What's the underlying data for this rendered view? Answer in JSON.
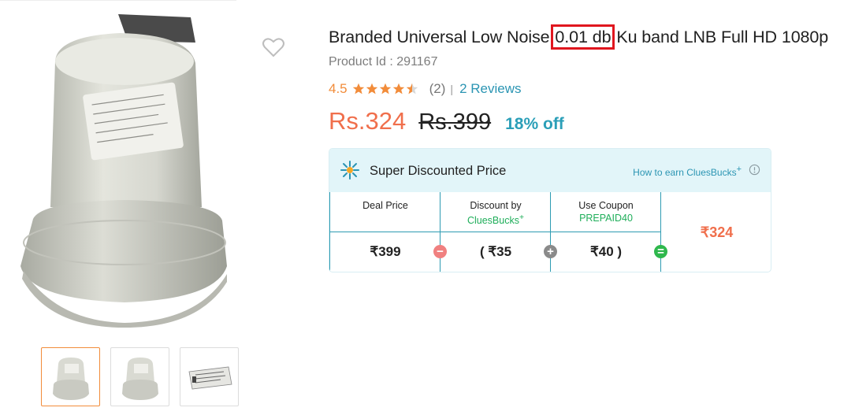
{
  "product": {
    "title_before": "Branded Universal Low Noise ",
    "title_highlight": "0.01 db",
    "title_after": " Ku band LNB Full HD 1080p",
    "product_id": "Product Id : 291167",
    "rating": "4.5",
    "stars": 4.5,
    "rating_count": "(2)",
    "separator": "|",
    "reviews_label": "2 Reviews",
    "price": "Rs.324",
    "mrp": "Rs.399",
    "discount": "18% off"
  },
  "offer": {
    "title": "Super Discounted Price",
    "earn_link": "How to earn CluesBucks",
    "earn_plus": "+",
    "columns": [
      {
        "label": "Deal Price",
        "sub": "",
        "value": "₹399"
      },
      {
        "label": "Discount by",
        "sub": "CluesBucks",
        "sub_plus": "+",
        "value": "(  ₹35"
      },
      {
        "label": "Use Coupon",
        "sub": "PREPAID40",
        "value": "₹40 )"
      }
    ],
    "op_minus": "−",
    "op_plus": "+",
    "op_equals": "=",
    "final_price": "₹324"
  },
  "icons": [
    "heart-icon",
    "star-icon",
    "discount-badge-icon",
    "info-icon"
  ],
  "colors": {
    "accent_orange": "#f06f4c",
    "rating_orange": "#f28c3a",
    "teal": "#2b95b3",
    "highlight_red": "#e0161e",
    "green": "#1fae5a",
    "offer_header_bg": "#e2f5f9"
  }
}
